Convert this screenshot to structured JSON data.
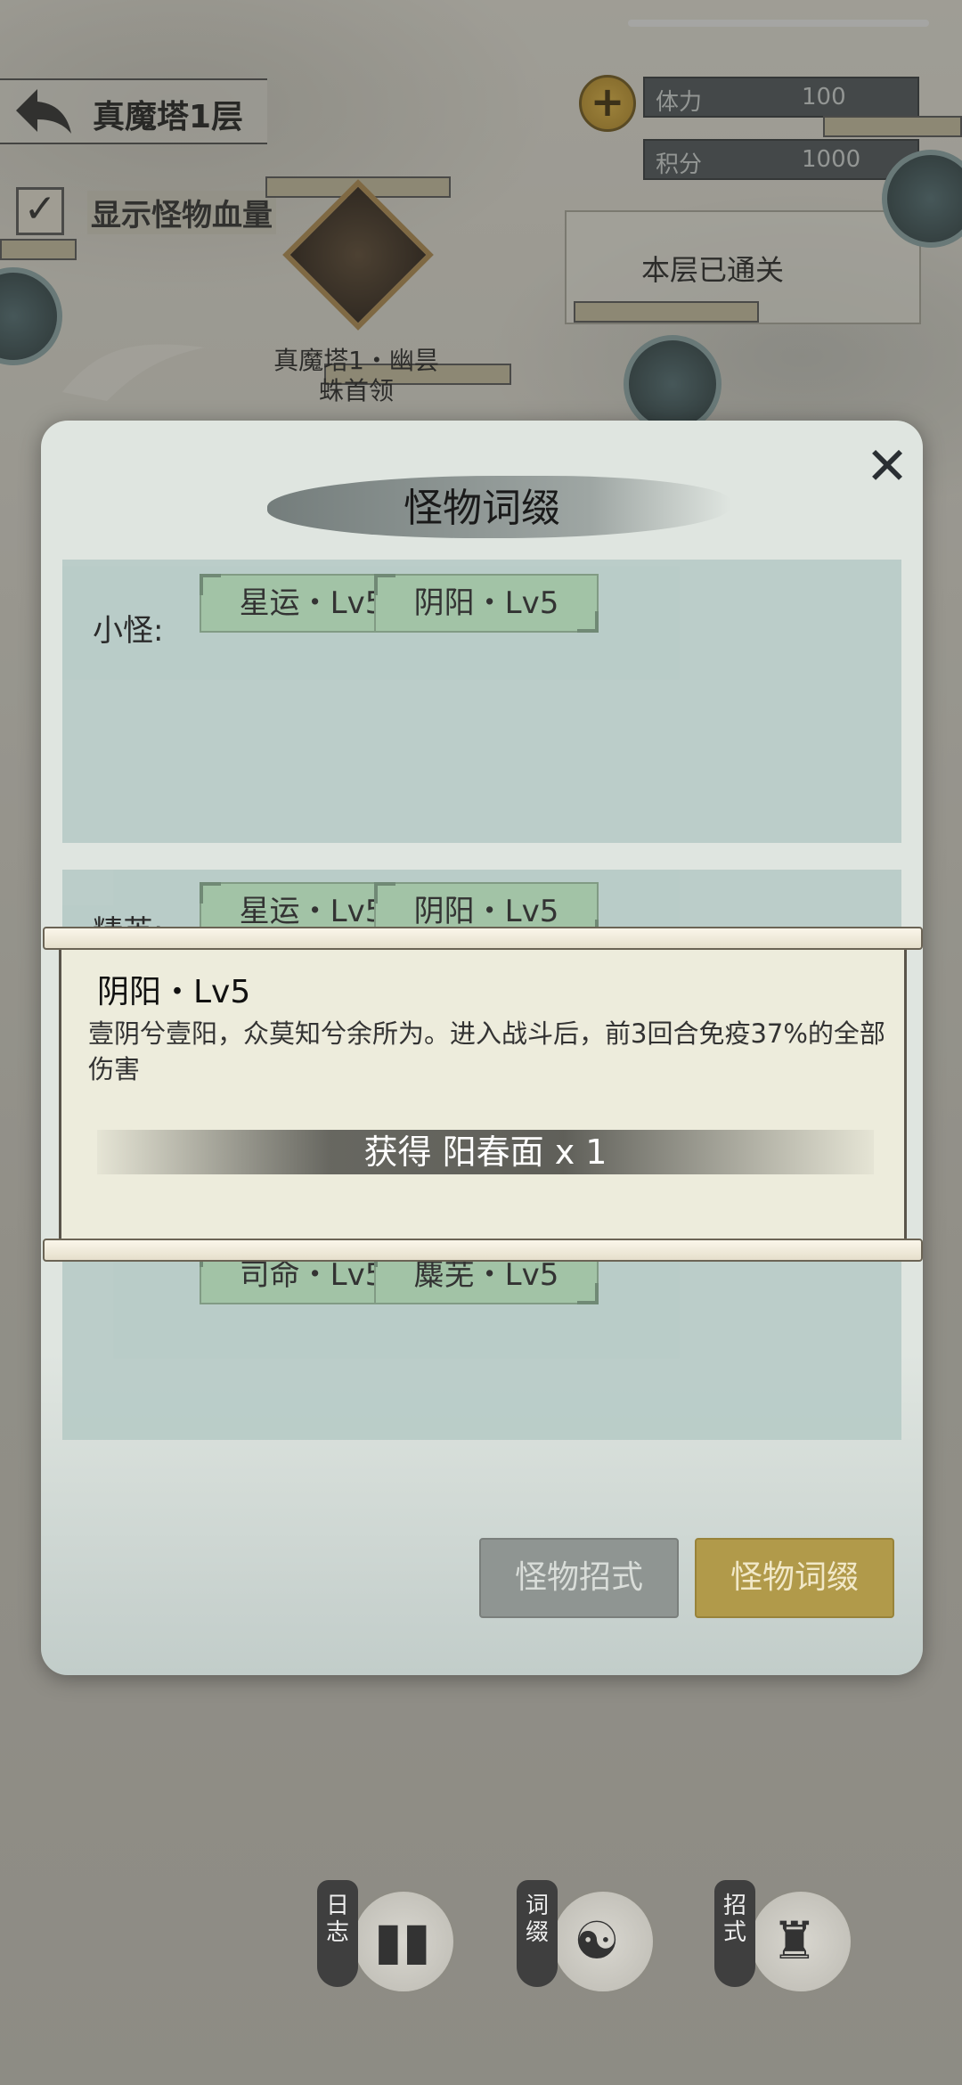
{
  "hud": {
    "floor_title": "真魔塔1层",
    "stamina_label": "体力",
    "stamina_value": "100",
    "points_label": "积分",
    "points_value": "1000",
    "plus_icon": "+",
    "show_hp_label": "显示怪物血量",
    "show_hp_checked": "✓",
    "cleared_text": "本层已通关",
    "boss_label": "真魔塔1・幽昙蛛首领"
  },
  "dialog": {
    "title": "怪物词缀",
    "close_icon": "✕",
    "sections": {
      "small": {
        "label": "小怪:",
        "tags": [
          "星运・Lv5",
          "阴阳・Lv5"
        ]
      },
      "elite": {
        "label": "精英:",
        "tags": [
          "星运・Lv5",
          "阴阳・Lv5"
        ]
      },
      "boss": {
        "tags": [
          "司命・Lv5",
          "麋芜・Lv5"
        ]
      }
    },
    "tabs": {
      "moves": "怪物招式",
      "affix": "怪物词缀"
    }
  },
  "popup": {
    "affix_name": "阴阳・Lv5",
    "description": "壹阴兮壹阳，众莫知兮余所为。进入战斗后，前3回合免疫37%的全部伤害",
    "reward": "获得 阳春面 x 1"
  },
  "dock": {
    "journal": "日志",
    "affix": "词缀",
    "moves": "招式"
  },
  "colors": {
    "tag_green": "#9fc2a3",
    "tab_gold": "#b19a4a",
    "tab_gray": "#8f9592",
    "dialog_bg": "#dfe5e0"
  }
}
